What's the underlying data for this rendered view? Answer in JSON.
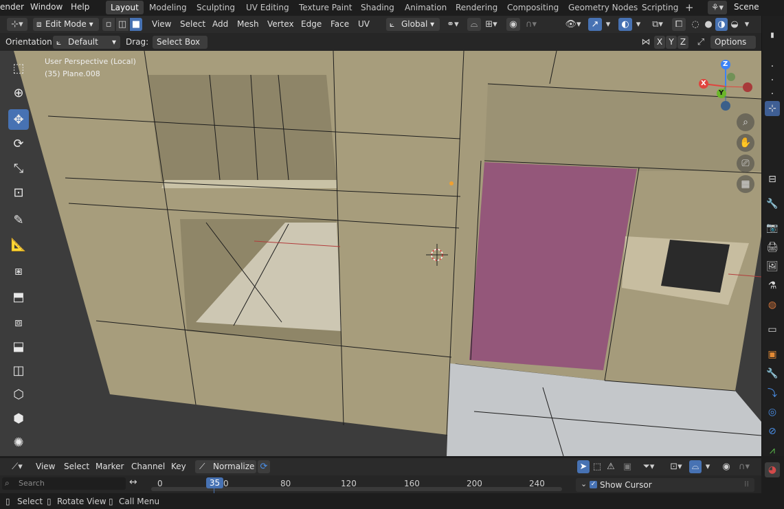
{
  "topbar": {
    "menu": [
      "ender",
      "Window",
      "Help"
    ],
    "workspaces": [
      "Layout",
      "Modeling",
      "Sculpting",
      "UV Editing",
      "Texture Paint",
      "Shading",
      "Animation",
      "Rendering",
      "Compositing",
      "Geometry Nodes",
      "Scripting"
    ],
    "active_workspace": "Layout",
    "add_tab": "+",
    "scene": "Scene"
  },
  "header": {
    "mode": "Edit Mode",
    "menus": [
      "View",
      "Select",
      "Add",
      "Mesh",
      "Vertex",
      "Edge",
      "Face",
      "UV"
    ],
    "transform_orientation": "Global"
  },
  "tool_settings": {
    "orientation_label": "Orientation:",
    "orientation_value": "Default",
    "drag_label": "Drag:",
    "drag_value": "Select Box",
    "axis_x": "X",
    "axis_y": "Y",
    "axis_z": "Z",
    "options": "Options"
  },
  "viewport": {
    "view_name": "User Perspective (Local)",
    "object_info": "(35) Plane.008",
    "gizmo": {
      "x": "X",
      "y": "Y",
      "z": "Z"
    },
    "colors": {
      "wall": "#a79d7c",
      "selected_face": "#94577a",
      "floor": "#c4c7ca",
      "ground": "#3c3c3c"
    }
  },
  "timeline": {
    "menus": [
      "View",
      "Select",
      "Marker",
      "Channel",
      "Key"
    ],
    "normalize": "Normalize",
    "search_placeholder": "Search",
    "current_frame": "35",
    "ticks": [
      "0",
      "0",
      "80",
      "120",
      "160",
      "200",
      "240"
    ],
    "show_cursor": "Show Cursor"
  },
  "statusbar": {
    "items": [
      "Select",
      "Rotate View",
      "Call Menu"
    ]
  }
}
